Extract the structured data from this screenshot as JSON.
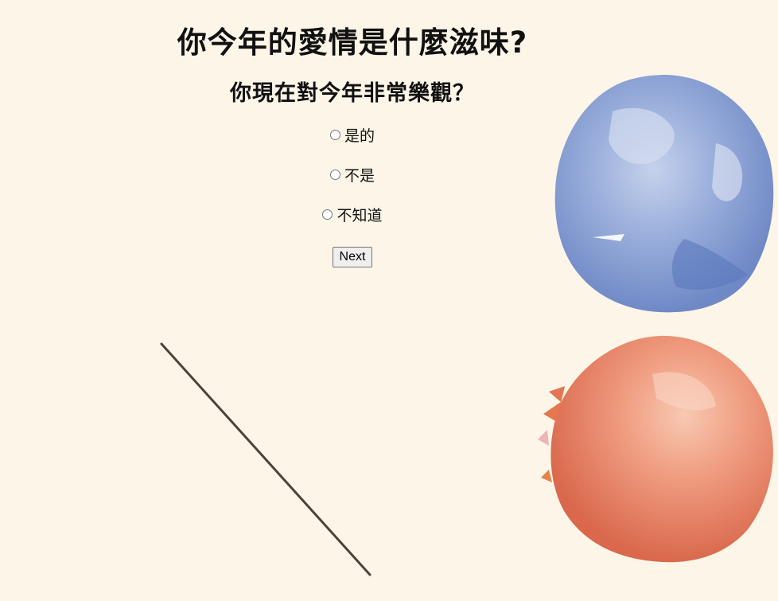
{
  "quiz": {
    "title": "你今年的愛情是什麼滋味?",
    "question": "你現在對今年非常樂觀？",
    "options": [
      {
        "label": "是的",
        "selected": false
      },
      {
        "label": "不是",
        "selected": false
      },
      {
        "label": "不知道",
        "selected": false
      }
    ],
    "next_label": "Next"
  },
  "decor": {
    "blue_circle_color": "#7f98cf",
    "orange_circle_color": "#e88468",
    "line_color": "#4e4136",
    "background": "#fdf5e8"
  }
}
